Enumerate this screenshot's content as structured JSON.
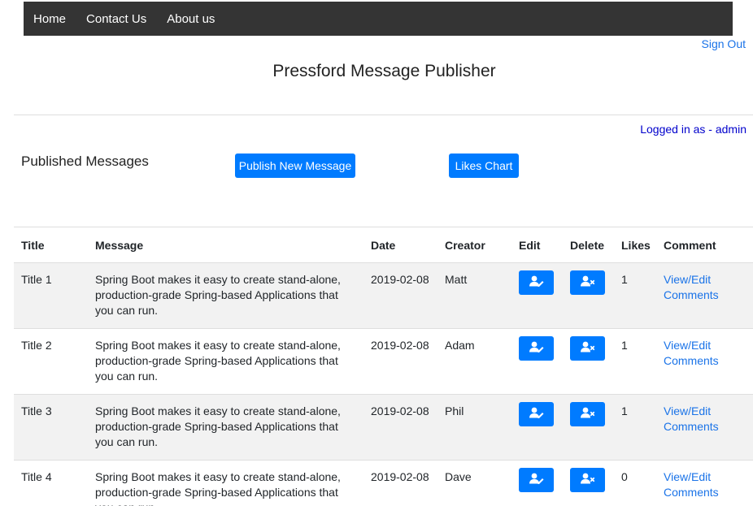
{
  "nav": {
    "items": [
      "Home",
      "Contact Us",
      "About us"
    ]
  },
  "signout": "Sign Out",
  "title": "Pressford Message Publisher",
  "logged_in": "Logged in as - admin",
  "section_title": "Published Messages",
  "buttons": {
    "publish": "Publish New Message",
    "chart": "Likes Chart"
  },
  "table": {
    "headers": [
      "Title",
      "Message",
      "Date",
      "Creator",
      "Edit",
      "Delete",
      "Likes",
      "Comment"
    ],
    "rows": [
      {
        "title": "Title 1",
        "message": "Spring Boot makes it easy to create stand-alone, production-grade Spring-based Applications that you can run.",
        "date": "2019-02-08",
        "creator": "Matt",
        "likes": "1",
        "comment": "View/Edit Comments"
      },
      {
        "title": "Title 2",
        "message": "Spring Boot makes it easy to create stand-alone, production-grade Spring-based Applications that you can run.",
        "date": "2019-02-08",
        "creator": "Adam",
        "likes": "1",
        "comment": "View/Edit Comments"
      },
      {
        "title": "Title 3",
        "message": "Spring Boot makes it easy to create stand-alone, production-grade Spring-based Applications that you can run.",
        "date": "2019-02-08",
        "creator": "Phil",
        "likes": "1",
        "comment": "View/Edit Comments"
      },
      {
        "title": "Title 4",
        "message": "Spring Boot makes it easy to create stand-alone, production-grade Spring-based Applications that you can run.",
        "date": "2019-02-08",
        "creator": "Dave",
        "likes": "0",
        "comment": "View/Edit Comments"
      }
    ]
  },
  "icons": {
    "edit": "user-edit-icon",
    "delete": "user-delete-icon"
  }
}
